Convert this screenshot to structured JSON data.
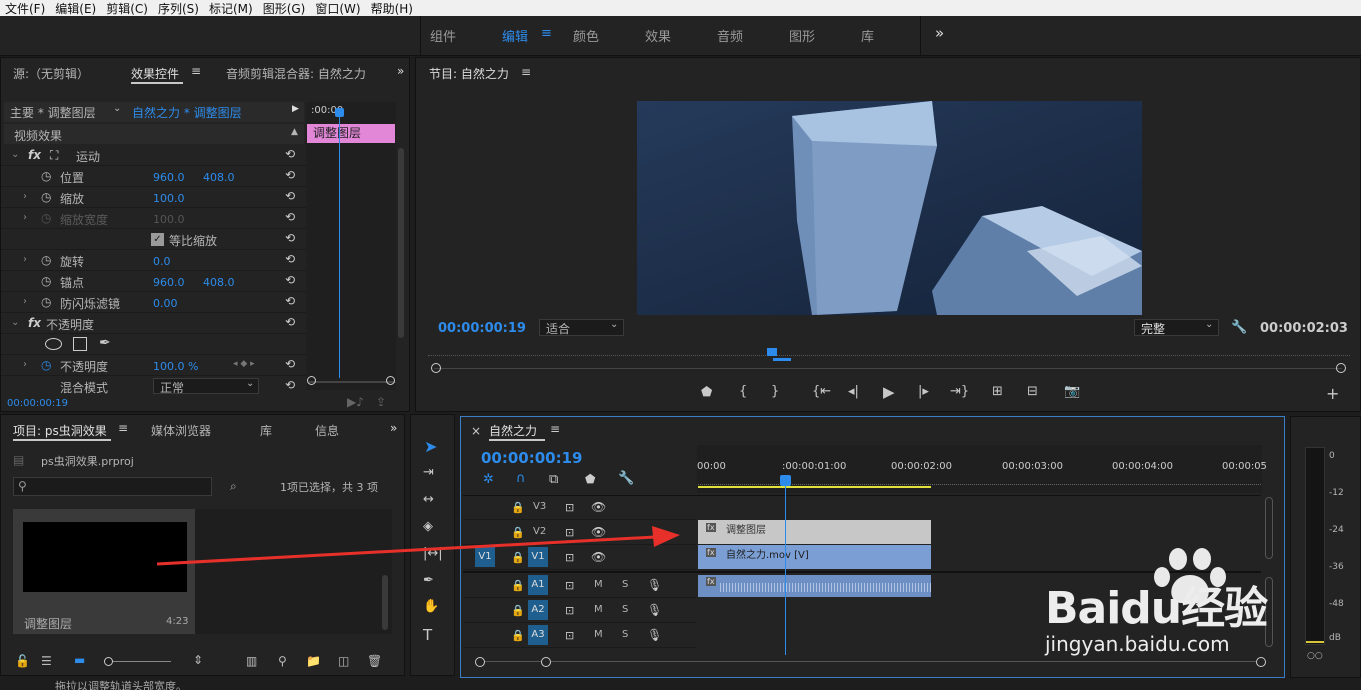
{
  "menu": [
    "文件(F)",
    "编辑(E)",
    "剪辑(C)",
    "序列(S)",
    "标记(M)",
    "图形(G)",
    "窗口(W)",
    "帮助(H)"
  ],
  "workspaces": {
    "items": [
      "组件",
      "编辑",
      "颜色",
      "效果",
      "音频",
      "图形",
      "库"
    ],
    "active": "编辑",
    "more": "»"
  },
  "top_left": {
    "tab_source": "源:（无剪辑）",
    "tab_effects": "效果控件",
    "tab_mixer": "音频剪辑混合器: 自然之力",
    "more": "»"
  },
  "effects": {
    "master": "主要 * 调整图层",
    "clip": "自然之力 * 调整图层",
    "timecode_head": ":00:00",
    "clip_bar": "调整图层",
    "section_video": "视频效果",
    "motion": "运动",
    "position_label": "位置",
    "position_x": "960.0",
    "position_y": "408.0",
    "scale_label": "缩放",
    "scale_val": "100.0",
    "scalew_label": "缩放宽度",
    "scalew_val": "100.0",
    "uniform_label": "等比缩放",
    "rotation_label": "旋转",
    "rotation_val": "0.0",
    "anchor_label": "锚点",
    "anchor_x": "960.0",
    "anchor_y": "408.0",
    "flicker_label": "防闪烁滤镜",
    "flicker_val": "0.00",
    "opacity_section": "不透明度",
    "opacity_label": "不透明度",
    "opacity_val": "100.0 %",
    "blend_label": "混合模式",
    "blend_val": "正常",
    "timecode": "00:00:00:19"
  },
  "program": {
    "title": "节目: 自然之力",
    "timecode": "00:00:00:19",
    "fit": "适合",
    "quality": "完整",
    "duration": "00:00:02:03"
  },
  "project": {
    "tab_project": "项目: ps虫洞效果",
    "tab_media": "媒体浏览器",
    "tab_lib": "库",
    "tab_info": "信息",
    "more": "»",
    "file": "ps虫洞效果.prproj",
    "selection": "1项已选择，共 3 项",
    "item_name": "调整图层",
    "item_duration": "4:23"
  },
  "timeline": {
    "close": "×",
    "title": "自然之力",
    "timecode": "00:00:00:19",
    "ruler": [
      "00:00",
      ":00:00:01:00",
      "00:00:02:00",
      "00:00:03:00",
      "00:00:04:00",
      "00:00:05"
    ],
    "tracks_v": [
      "V3",
      "V2",
      "V1"
    ],
    "tracks_a": [
      "A1",
      "A2",
      "A3"
    ],
    "src_v": "V1",
    "clip_adjust": "调整图层",
    "clip_video": "自然之力.mov [V]",
    "m": "M",
    "s": "S"
  },
  "meter": {
    "labels": [
      "0",
      "-12",
      "-24",
      "-36",
      "-48",
      "dB"
    ]
  },
  "watermark": {
    "brand": "Baidu经验",
    "url": "jingyan.baidu.com"
  },
  "status": "拖拉以调整轨道头部宽度。",
  "colors": {
    "accent": "#2d8ceb",
    "clip_pink": "#e286d8",
    "clip_gray": "#c7c7c7",
    "clip_blue": "#7b9fd4",
    "track_blue": "#1f5f8f",
    "arrow": "#e8302a"
  }
}
